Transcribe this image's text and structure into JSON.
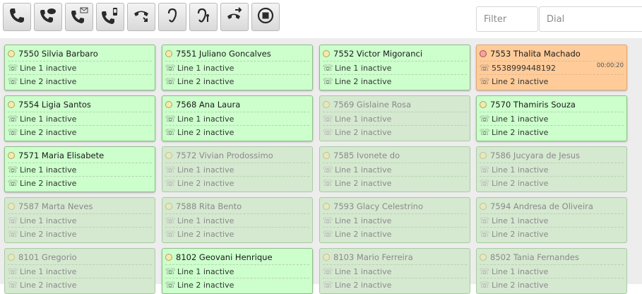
{
  "toolbar": {
    "buttons": [
      {
        "name": "call-button"
      },
      {
        "name": "message-button"
      },
      {
        "name": "voicemail-button"
      },
      {
        "name": "sms-button"
      },
      {
        "name": "hangup-button"
      },
      {
        "name": "listen-button"
      },
      {
        "name": "whisper-button"
      },
      {
        "name": "transfer-button"
      },
      {
        "name": "stop-button"
      }
    ],
    "filter_placeholder": "Filter",
    "dial_placeholder": "Dial"
  },
  "extensions": [
    {
      "label": "7550 Silvia Barbaro",
      "state": "active",
      "line1": "Line 1 inactive",
      "line2": "Line 2 inactive"
    },
    {
      "label": "7551 Juliano Goncalves",
      "state": "active",
      "line1": "Line 1 inactive",
      "line2": "Line 2 inactive"
    },
    {
      "label": "7552 Victor Migoranci",
      "state": "active",
      "line1": "Line 1 inactive",
      "line2": "Line 2 inactive"
    },
    {
      "label": "7553 Thalita Machado",
      "state": "busy",
      "line1": "5538999448192",
      "line1_timer": "00:00:20",
      "line2": "Line 2 inactive"
    },
    {
      "label": "7554 Ligia Santos",
      "state": "active",
      "line1": "Line 1 inactive",
      "line2": "Line 2 inactive"
    },
    {
      "label": "7568 Ana Laura",
      "state": "active",
      "line1": "Line 1 inactive",
      "line2": "Line 2 inactive"
    },
    {
      "label": "7569 Gislaine Rosa",
      "state": "offline",
      "line1": "Line 1 inactive",
      "line2": "Line 2 inactive"
    },
    {
      "label": "7570 Thamiris Souza",
      "state": "active",
      "line1": "Line 1 inactive",
      "line2": "Line 2 inactive"
    },
    {
      "label": "7571 Maria Elisabete",
      "state": "active",
      "line1": "Line 1 inactive",
      "line2": "Line 2 inactive"
    },
    {
      "label": "7572 Vivian Prodossimo",
      "state": "offline",
      "line1": "Line 1 inactive",
      "line2": "Line 2 inactive"
    },
    {
      "label": "7585 Ivonete do",
      "state": "offline",
      "line1": "Line 1 inactive",
      "line2": "Line 2 inactive"
    },
    {
      "label": "7586 Jucyara de Jesus",
      "state": "offline",
      "line1": "Line 1 inactive",
      "line2": "Line 2 inactive"
    },
    {
      "label": "7587 Marta Neves",
      "state": "offline",
      "line1": "Line 1 inactive",
      "line2": "Line 2 inactive"
    },
    {
      "label": "7588 Rita Bento",
      "state": "offline",
      "line1": "Line 1 inactive",
      "line2": "Line 2 inactive"
    },
    {
      "label": "7593 Glacy Celestrino",
      "state": "offline",
      "line1": "Line 1 inactive",
      "line2": "Line 2 inactive"
    },
    {
      "label": "7594 Andresa de Oliveira",
      "state": "offline",
      "line1": "Line 1 inactive",
      "line2": "Line 2 inactive"
    },
    {
      "label": "8101 Gregorio",
      "state": "offline",
      "line1": "Line 1 inactive",
      "line2": "Line 2 inactive"
    },
    {
      "label": "8102 Geovani Henrique",
      "state": "active",
      "line1": "Line 1 inactive",
      "line2": "Line 2 inactive"
    },
    {
      "label": "8103 Mario Ferreira",
      "state": "offline",
      "line1": "Line 1 inactive",
      "line2": "Line 2 inactive"
    },
    {
      "label": "8502 Tania Fernandes",
      "state": "offline",
      "line1": "Line 1 inactive",
      "line2": "Line 2 inactive"
    }
  ],
  "colors": {
    "active_bg": "#ccffcc",
    "offline_bg": "#d5e8d0",
    "busy_bg": "#ffcc99",
    "page_bg": "#ededed"
  }
}
